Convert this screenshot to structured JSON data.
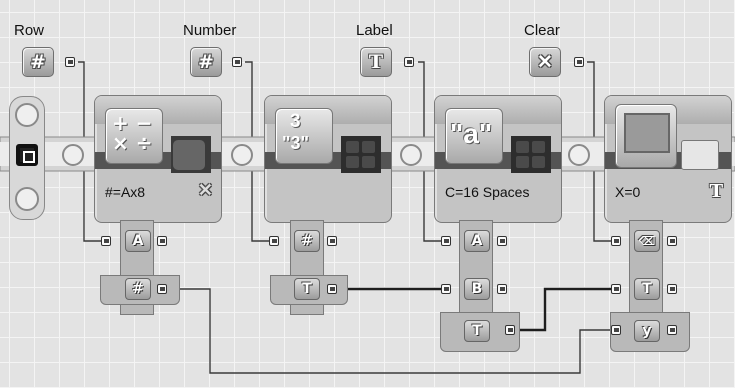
{
  "inputs": [
    {
      "label": "Row",
      "icon_name": "number-icon",
      "glyph": "#"
    },
    {
      "label": "Number",
      "icon_name": "number-icon",
      "glyph": "#"
    },
    {
      "label": "Label",
      "icon_name": "text-icon",
      "glyph": "T"
    },
    {
      "label": "Clear",
      "icon_name": "clear-icon",
      "glyph": "✕"
    }
  ],
  "blocks": [
    {
      "name": "math",
      "caption": "#=Ax8",
      "corner": "✕",
      "icon_name": "math-icon",
      "ports": [
        "A",
        "#"
      ]
    },
    {
      "name": "number-to-text",
      "caption": "",
      "icon_name": "number-to-text-icon",
      "ports": [
        "#",
        "T"
      ]
    },
    {
      "name": "text",
      "caption": "C=16 Spaces",
      "icon_name": "text-icon",
      "ports": [
        "A",
        "B",
        "T"
      ]
    },
    {
      "name": "display",
      "caption": "X=0",
      "corner": "T",
      "icon_name": "display-icon",
      "ports": [
        "eraser",
        "T",
        "y"
      ]
    }
  ],
  "glyphs": {
    "math": "+ −\n× ÷",
    "num_to_text_top": "3",
    "num_to_text_bottom": "\"3\"",
    "text_a": "\"a\""
  },
  "colors": {
    "background": "#e3e3e3",
    "wire": "#2a2a2a",
    "block": "#c4c4c4",
    "band": "#545454"
  }
}
